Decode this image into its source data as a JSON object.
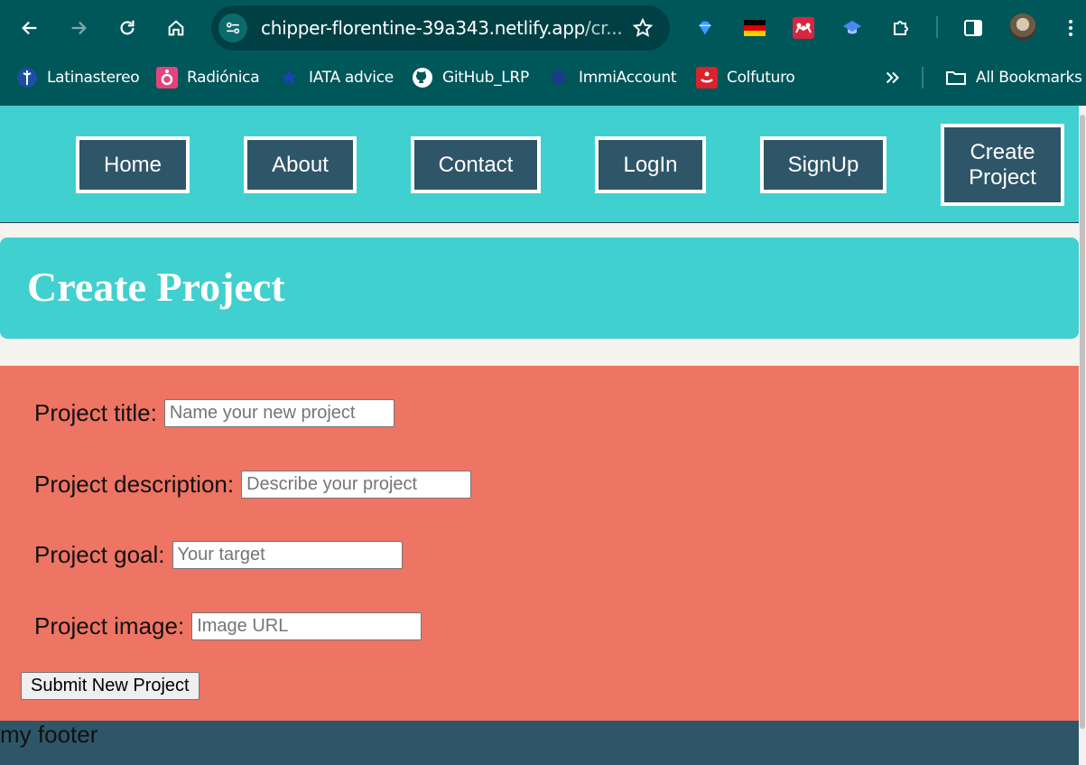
{
  "browser": {
    "url_host": "chipper-florentine-39a343.netlify.app",
    "url_rest": "/cr...",
    "bookmarks": [
      {
        "label": "Latinastereo",
        "icon": "latinastereo-icon"
      },
      {
        "label": "Radiónica",
        "icon": "radionica-icon"
      },
      {
        "label": "IATA advice",
        "icon": "iata-icon"
      },
      {
        "label": "GitHub_LRP",
        "icon": "github-icon"
      },
      {
        "label": "ImmiAccount",
        "icon": "immiaccount-icon"
      },
      {
        "label": "Colfuturo",
        "icon": "colfuturo-icon"
      }
    ],
    "all_bookmarks_label": "All Bookmarks"
  },
  "nav": {
    "items": [
      {
        "label": "Home"
      },
      {
        "label": "About"
      },
      {
        "label": "Contact"
      },
      {
        "label": "LogIn"
      },
      {
        "label": "SignUp"
      },
      {
        "label": "Create Project"
      }
    ]
  },
  "hero": {
    "title": "Create Project"
  },
  "form": {
    "fields": [
      {
        "label": "Project title:",
        "placeholder": "Name your new project",
        "value": ""
      },
      {
        "label": "Project description:",
        "placeholder": "Describe your project",
        "value": ""
      },
      {
        "label": "Project goal:",
        "placeholder": "Your target",
        "value": ""
      },
      {
        "label": "Project image:",
        "placeholder": "Image URL",
        "value": ""
      }
    ],
    "submit_label": "Submit New Project"
  },
  "footer": {
    "text": "my footer"
  },
  "colors": {
    "chrome": "#00575a",
    "nav_bg": "#40d0cf",
    "button_bg": "#2f5568",
    "form_bg": "#ee7463",
    "footer_bg": "#2f5568"
  }
}
